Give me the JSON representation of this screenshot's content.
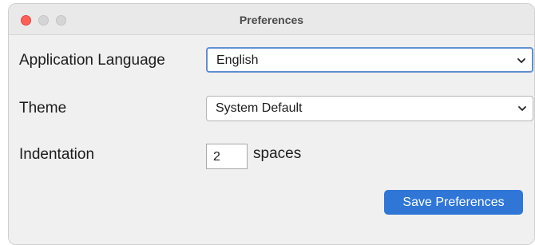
{
  "window": {
    "title": "Preferences"
  },
  "form": {
    "language_label": "Application Language",
    "language_value": "English",
    "theme_label": "Theme",
    "theme_value": "System Default",
    "indentation_label": "Indentation",
    "indentation_value": "2",
    "indentation_unit": "spaces"
  },
  "actions": {
    "save_label": "Save Preferences"
  },
  "colors": {
    "accent": "#2f76d7",
    "close": "#fe5f57",
    "focus_ring": "#5f8fd3"
  }
}
